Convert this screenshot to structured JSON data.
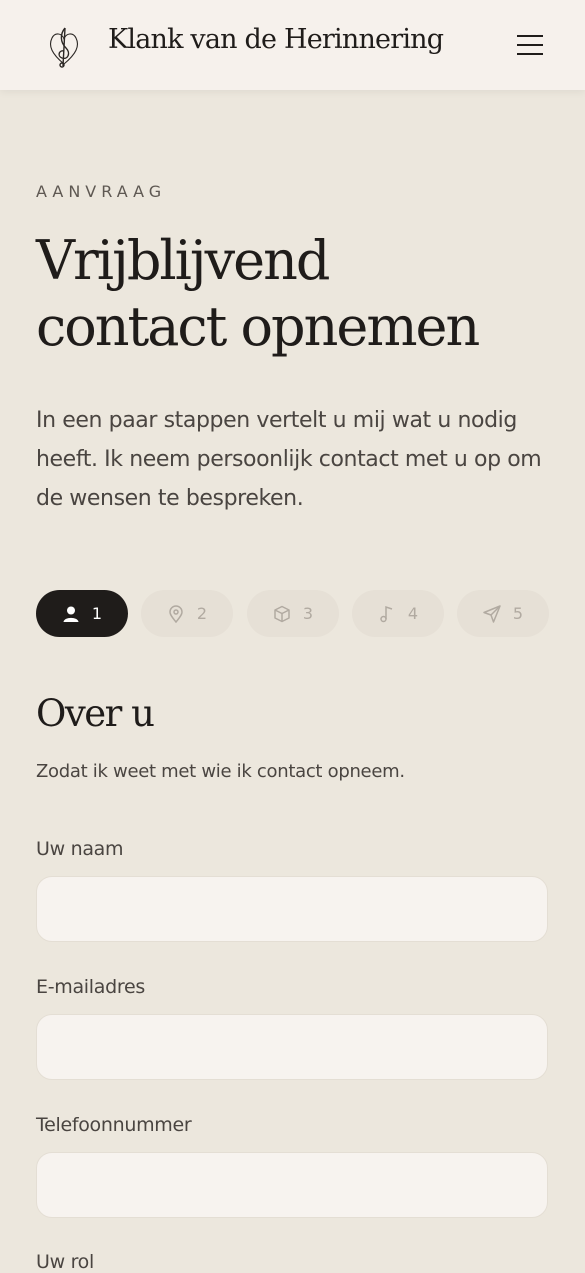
{
  "header": {
    "site_title": "Klank van de Herinnering",
    "logo_icon": "treble-clef-heart-icon",
    "menu_icon": "hamburger-menu-icon"
  },
  "hero": {
    "eyebrow": "AANVRAAG",
    "title_line1": "Vrijblijvend",
    "title_line2": "contact opnemen",
    "intro": "In een paar stappen vertelt u mij wat u nodig heeft. Ik neem persoonlijk contact met u op om de wensen te bespreken."
  },
  "steps": [
    {
      "number": "1",
      "icon": "user-icon",
      "active": true
    },
    {
      "number": "2",
      "icon": "location-pin-icon",
      "active": false
    },
    {
      "number": "3",
      "icon": "box-icon",
      "active": false
    },
    {
      "number": "4",
      "icon": "music-note-icon",
      "active": false
    },
    {
      "number": "5",
      "icon": "send-icon",
      "active": false
    }
  ],
  "section": {
    "title": "Over u",
    "subtitle": "Zodat ik weet met wie ik contact opneem."
  },
  "form": {
    "name_label": "Uw naam",
    "name_value": "",
    "email_label": "E-mailadres",
    "email_value": "",
    "phone_label": "Telefoonnummer",
    "phone_value": "",
    "role_label": "Uw rol"
  },
  "colors": {
    "background": "#ECE7DD",
    "header_background": "#F6F1EC",
    "accent_dark": "#1f1c1a",
    "input_background": "#F7F3EF"
  }
}
